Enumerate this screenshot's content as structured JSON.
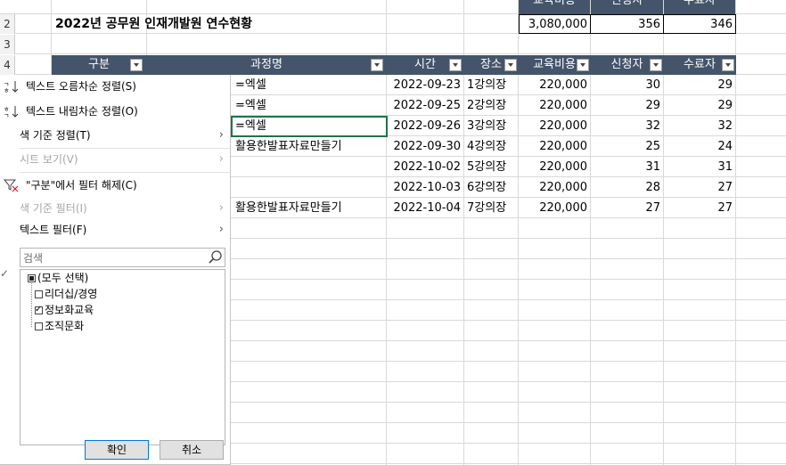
{
  "title": "2022년 공무원 인재개발원 연수현황",
  "rows": [
    "2",
    "3",
    "4"
  ],
  "summary": {
    "cost": "3,080,000",
    "applicants": "356",
    "completers": "346",
    "cost_label": "교육비용",
    "applicants_label": "신청자",
    "completers_label": "수료자"
  },
  "headers": {
    "category": "구분",
    "course": "과정명",
    "time": "시간",
    "place": "장소",
    "cost": "교육비용",
    "applicants": "신청자",
    "completers": "수료자"
  },
  "table_rows": [
    {
      "course": "=엑셀",
      "date": "2022-09-23",
      "place": "1강의장",
      "cost": "220,000",
      "applicants": "30",
      "completers": "29"
    },
    {
      "course": "=엑셀",
      "date": "2022-09-25",
      "place": "2강의장",
      "cost": "220,000",
      "applicants": "29",
      "completers": "29"
    },
    {
      "course": "=엑셀",
      "date": "2022-09-26",
      "place": "3강의장",
      "cost": "220,000",
      "applicants": "32",
      "completers": "32"
    },
    {
      "course": "활용한발표자료만들기",
      "date": "2022-09-30",
      "place": "4강의장",
      "cost": "220,000",
      "applicants": "25",
      "completers": "24"
    },
    {
      "course": "",
      "date": "2022-10-02",
      "place": "5강의장",
      "cost": "220,000",
      "applicants": "31",
      "completers": "31"
    },
    {
      "course": "",
      "date": "2022-10-03",
      "place": "6강의장",
      "cost": "220,000",
      "applicants": "28",
      "completers": "27"
    },
    {
      "course": "활용한발표자료만들기",
      "date": "2022-10-04",
      "place": "7강의장",
      "cost": "220,000",
      "applicants": "27",
      "completers": "27"
    }
  ],
  "menu": {
    "sort_asc": "텍스트 오름차순 정렬(S)",
    "sort_desc": "텍스트 내림차순 정렬(O)",
    "sort_color": "색 기준 정렬(T)",
    "sheet_view": "시트 보기(V)",
    "clear_filter": "\"구분\"에서 필터 해제(C)",
    "filter_color": "색 기준 필터(I)",
    "text_filter": "텍스트 필터(F)",
    "search_placeholder": "검색",
    "tree": [
      {
        "label": "(모두 선택)",
        "state": "partial"
      },
      {
        "label": "리더십/경영",
        "state": "unchecked"
      },
      {
        "label": "정보화교육",
        "state": "checked"
      },
      {
        "label": "조직문화",
        "state": "unchecked"
      }
    ],
    "ok": "확인",
    "cancel": "취소"
  },
  "colors": {
    "header_bg": "#44546a",
    "selection": "#217346",
    "button_focus": "#0078d7"
  }
}
